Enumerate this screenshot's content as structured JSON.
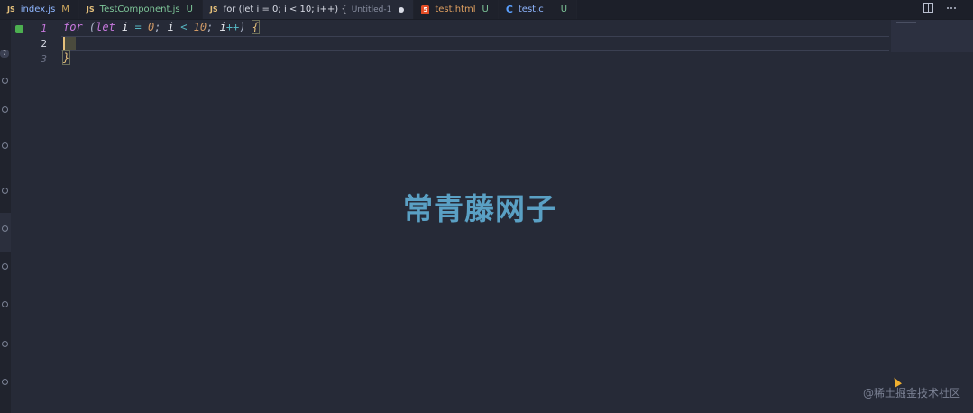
{
  "tabs": [
    {
      "icon": "JS",
      "name": "index.js",
      "badge": "M",
      "style": "blue",
      "badge_style": "m"
    },
    {
      "icon": "JS",
      "name": "TestComponent.js",
      "badge": "U",
      "style": "green",
      "badge_style": "u"
    },
    {
      "icon": "JS",
      "name": "for (let i = 0; i < 10; i++) {",
      "desc": "Untitled-1",
      "active": true
    },
    {
      "icon": "5",
      "name": "test.html",
      "badge": "U",
      "style": "orange",
      "badge_style": "u"
    },
    {
      "icon": "C",
      "name": "test.c",
      "badge": "U",
      "style": "blue",
      "badge_style": "u"
    }
  ],
  "activity_badge": "7",
  "line_numbers": [
    "1",
    "2",
    "3"
  ],
  "code": {
    "line1": {
      "kw_for": "for",
      "paren_open": "(",
      "kw_let": "let",
      "var_i": "i",
      "op_eq": "=",
      "num_0": "0",
      "semi1": ";",
      "var_i2": "i",
      "op_lt": "<",
      "num_10": "10",
      "semi2": ";",
      "var_i3": "i",
      "op_inc": "++",
      "paren_close": ")",
      "brace_open": "{"
    },
    "line3": {
      "brace_close": "}"
    }
  },
  "watermark": "常青藤网子",
  "credit": "@稀土掘金技术社区",
  "colors": {
    "background": "#262a37",
    "tabbar": "#1c1f29",
    "keyword": "#c678dd",
    "number": "#d19a66",
    "operator": "#56b6c2",
    "bracket": "#e5c07b",
    "git_added": "#4caf50",
    "watermark": "#5aa0c4"
  },
  "icons": {
    "split_editor": "split-editor-icon",
    "more_actions": "more-actions-icon"
  }
}
